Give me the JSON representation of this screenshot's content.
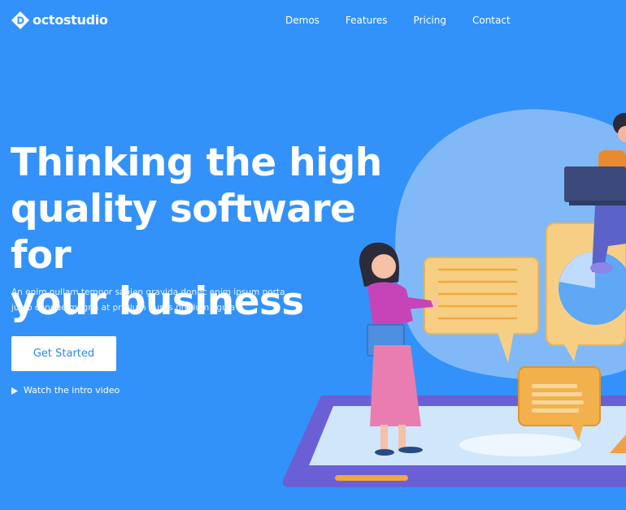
{
  "brand": {
    "name": "octostudio",
    "icon": "octostudio-logo-icon"
  },
  "nav": {
    "items": [
      {
        "label": "Demos"
      },
      {
        "label": "Features"
      },
      {
        "label": "Pricing"
      },
      {
        "label": "Contact"
      }
    ]
  },
  "hero": {
    "title_line1": "Thinking the high",
    "title_line2": "quality software for",
    "title_line3": "your business",
    "subtitle_line1": "An enim nullam tempor sapien gravida donec enim ipsum porta",
    "subtitle_line2": "justo  congue magna at pretium purus pretium ligula",
    "cta_label": "Get Started",
    "video_link_label": "Watch the intro video",
    "video_icon": "play-icon"
  },
  "illustration": {
    "name": "people-with-chat-bubbles-and-laptop-illustration"
  },
  "colors": {
    "background": "#3292f9",
    "cta_text": "#2f86ee",
    "bubble": "#f7cf84",
    "bubble_lines": "#f0a93c",
    "platform": "#6b5fd6",
    "blob": "#8fc0f8"
  }
}
